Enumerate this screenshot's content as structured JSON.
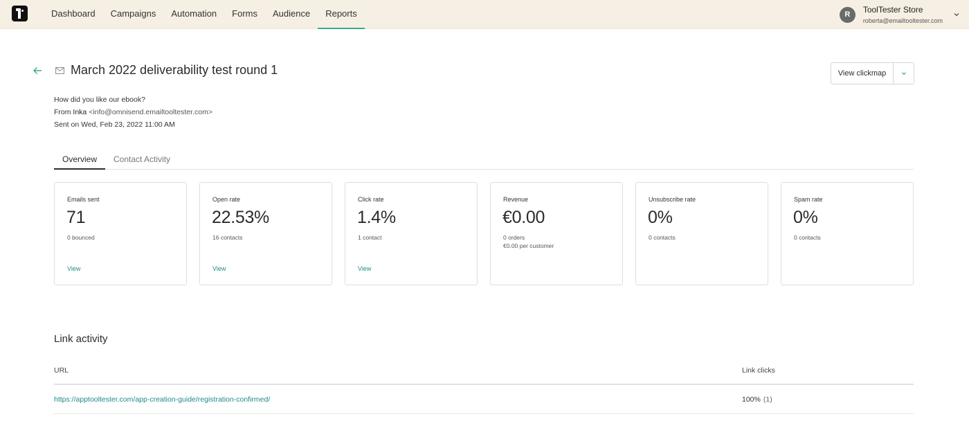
{
  "nav": {
    "items": [
      {
        "label": "Dashboard",
        "active": false
      },
      {
        "label": "Campaigns",
        "active": false
      },
      {
        "label": "Automation",
        "active": false
      },
      {
        "label": "Forms",
        "active": false
      },
      {
        "label": "Audience",
        "active": false
      },
      {
        "label": "Reports",
        "active": true
      }
    ],
    "active_color": "#3aaa8c"
  },
  "account": {
    "avatar_initial": "R",
    "store_name": "ToolTester Store",
    "email": "roberta@emailtooltester.com"
  },
  "campaign": {
    "title": "March 2022 deliverability test round 1",
    "subject": "How did you like our ebook?",
    "from_prefix": "From ",
    "from_name": "Inka",
    "from_email": " <info@omnisend.emailtooltester.com>",
    "sent_on": "Sent on Wed, Feb 23, 2022 11:00 AM"
  },
  "actions": {
    "view_clickmap": "View clickmap"
  },
  "tabs": [
    {
      "label": "Overview",
      "active": true
    },
    {
      "label": "Contact Activity",
      "active": false
    }
  ],
  "stats": [
    {
      "label": "Emails sent",
      "value": "71",
      "sub": [
        "0 bounced"
      ],
      "link": "View"
    },
    {
      "label": "Open rate",
      "value": "22.53%",
      "sub": [
        "16 contacts"
      ],
      "link": "View"
    },
    {
      "label": "Click rate",
      "value": "1.4%",
      "sub": [
        "1 contact"
      ],
      "link": "View"
    },
    {
      "label": "Revenue",
      "value": "€0.00",
      "sub": [
        "0 orders",
        "€0.00 per customer"
      ],
      "link": ""
    },
    {
      "label": "Unsubscribe rate",
      "value": "0%",
      "sub": [
        "0 contacts"
      ],
      "link": ""
    },
    {
      "label": "Spam rate",
      "value": "0%",
      "sub": [
        "0 contacts"
      ],
      "link": ""
    }
  ],
  "link_activity": {
    "title": "Link activity",
    "columns": {
      "url": "URL",
      "clicks": "Link clicks"
    },
    "rows": [
      {
        "url": "https://apptooltester.com/app-creation-guide/registration-confirmed/",
        "percent": "100%",
        "count": "(1)"
      }
    ]
  },
  "colors": {
    "topbar_bg": "#f6efe3",
    "link": "#1f8a84"
  }
}
